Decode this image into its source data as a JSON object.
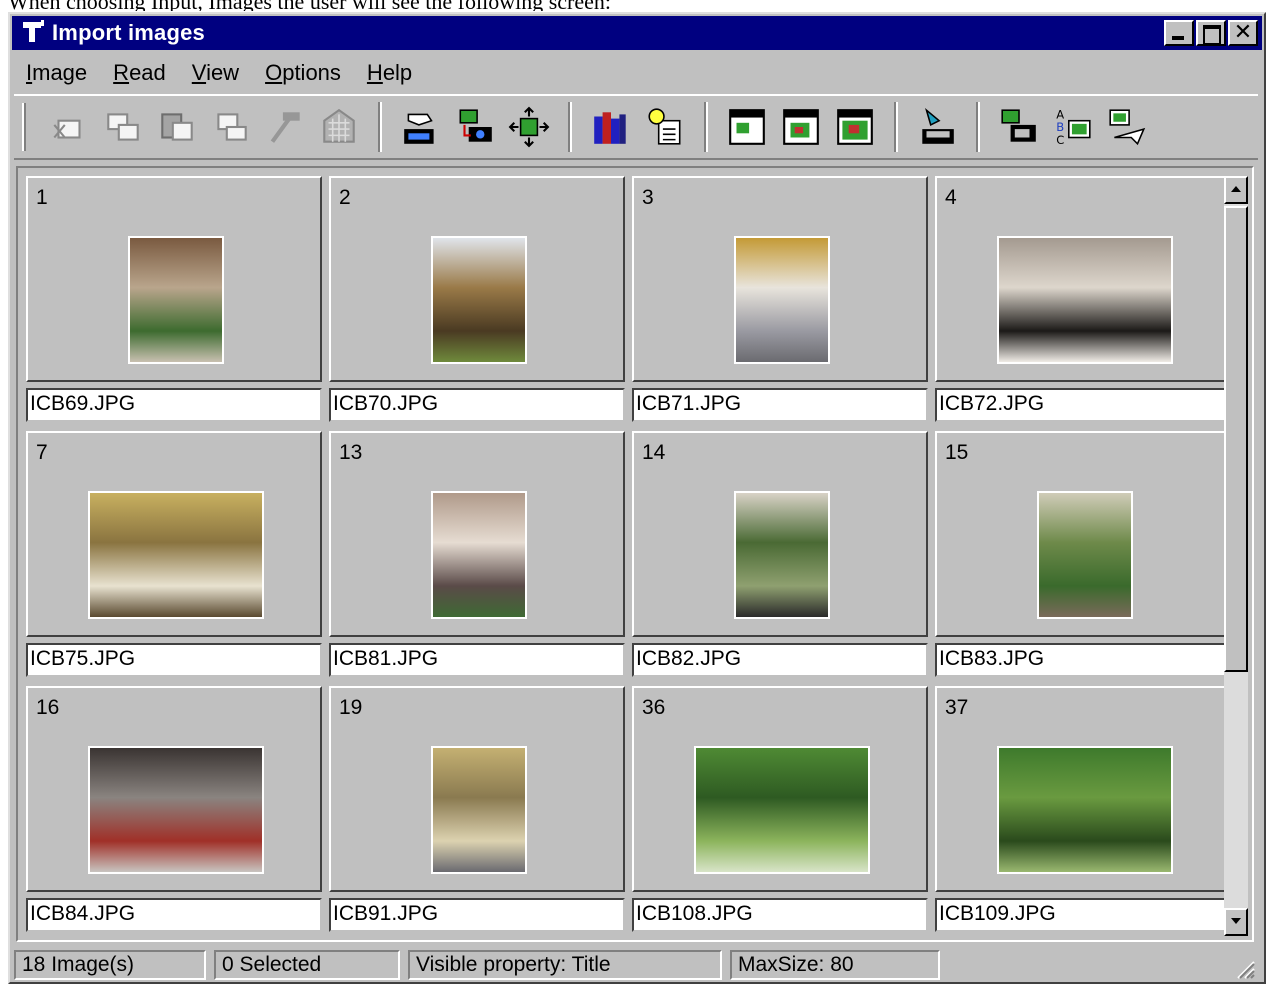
{
  "caption": "When choosing Input, Images the user will see the following screen:",
  "window": {
    "title": "Import images",
    "icon": "filter-funnel-icon"
  },
  "menu": [
    {
      "label": "Image"
    },
    {
      "label": "Read"
    },
    {
      "label": "View"
    },
    {
      "label": "Options"
    },
    {
      "label": "Help"
    }
  ],
  "toolbar": {
    "groups": [
      [
        "cut-image-icon",
        "copy-image-icon",
        "paste-image-icon",
        "delete-image-icon",
        "tools-hammer-icon",
        "grid-filter-icon"
      ],
      [
        "scanner-hand-icon",
        "camera-import-icon",
        "fit-crosshair-icon"
      ],
      [
        "books-icon",
        "idea-document-icon"
      ],
      [
        "window-small-icon",
        "window-medium-icon",
        "window-large-icon"
      ],
      [
        "export-tray-icon"
      ],
      [
        "camera-export-icon",
        "abc-sort-icon",
        "send-plane-icon"
      ]
    ]
  },
  "images": [
    {
      "num": "1",
      "file": "ICB69.JPG",
      "orient": "portrait",
      "colors": [
        "#7a5a40",
        "#b9a58c",
        "#3d6b2f",
        "#c8c0b0"
      ]
    },
    {
      "num": "2",
      "file": "ICB70.JPG",
      "orient": "portrait",
      "colors": [
        "#e0e4ea",
        "#9a7a48",
        "#4a3a22",
        "#6f8a3c"
      ]
    },
    {
      "num": "3",
      "file": "ICB71.JPG",
      "orient": "portrait",
      "colors": [
        "#c49a36",
        "#e8e4dc",
        "#9a9aa2",
        "#6b6b70"
      ]
    },
    {
      "num": "4",
      "file": "ICB72.JPG",
      "orient": "landscape",
      "colors": [
        "#a49a90",
        "#ddd6cc",
        "#1c1a18",
        "#f0ece6"
      ]
    },
    {
      "num": "7",
      "file": "ICB75.JPG",
      "orient": "landscape",
      "colors": [
        "#c8b060",
        "#8a7440",
        "#e8e2d0",
        "#5a4a30"
      ]
    },
    {
      "num": "13",
      "file": "ICB81.JPG",
      "orient": "portrait",
      "colors": [
        "#b09a8a",
        "#e6dcd2",
        "#5a4a48",
        "#3f6a34"
      ]
    },
    {
      "num": "14",
      "file": "ICB82.JPG",
      "orient": "portrait",
      "colors": [
        "#d8d2c6",
        "#4a6a34",
        "#8fa070",
        "#2a2a2a"
      ]
    },
    {
      "num": "15",
      "file": "ICB83.JPG",
      "orient": "portrait",
      "colors": [
        "#d0ccb8",
        "#6e8a4a",
        "#3a6a2c",
        "#7a6a5a"
      ]
    },
    {
      "num": "16",
      "file": "ICB84.JPG",
      "orient": "landscape",
      "colors": [
        "#3a3432",
        "#8a8480",
        "#a03028",
        "#c8c4c0"
      ]
    },
    {
      "num": "19",
      "file": "ICB91.JPG",
      "orient": "portrait",
      "colors": [
        "#c4b072",
        "#8a7a50",
        "#dcd2b0",
        "#6a6a70"
      ]
    },
    {
      "num": "36",
      "file": "ICB108.JPG",
      "orient": "landscape",
      "colors": [
        "#4f8a34",
        "#2e5a22",
        "#8cb45c",
        "#d8e4c8"
      ]
    },
    {
      "num": "37",
      "file": "ICB109.JPG",
      "orient": "landscape",
      "colors": [
        "#3e7a2c",
        "#6a9a40",
        "#2a4a1c",
        "#9ab870"
      ]
    }
  ],
  "status": {
    "count": "18 Image(s)",
    "selected": "0 Selected",
    "property": "Visible property: Title",
    "maxsize": "MaxSize: 80"
  },
  "colors": {
    "titlebar": "#000080",
    "face": "#c0c0c0"
  }
}
